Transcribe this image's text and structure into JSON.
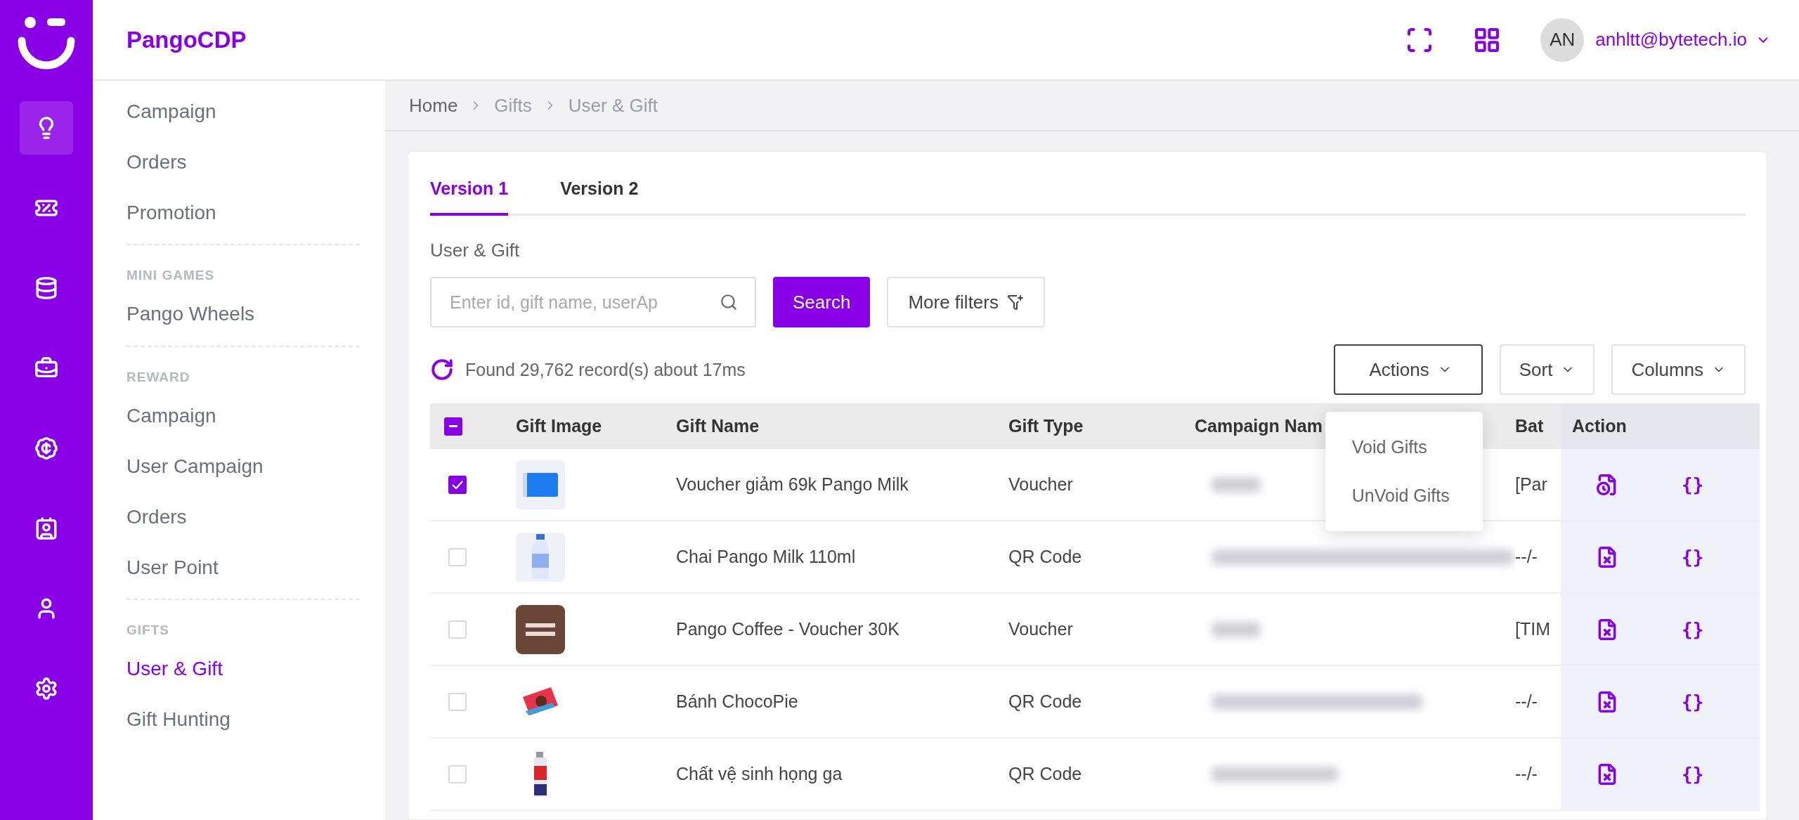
{
  "app": {
    "brand": "PangoCDP"
  },
  "rail": [
    {
      "selected": true
    },
    {
      "selected": false
    },
    {
      "selected": false
    },
    {
      "selected": false
    },
    {
      "selected": false
    },
    {
      "selected": false
    },
    {
      "selected": false
    },
    {
      "selected": false
    }
  ],
  "user": {
    "initials": "AN",
    "email": "anhltt@bytetech.io"
  },
  "sidebar": {
    "sections": [
      {
        "items": [
          {
            "label": "Campaign",
            "selected": false
          },
          {
            "label": "Orders",
            "selected": false
          },
          {
            "label": "Promotion",
            "selected": false
          }
        ]
      },
      {
        "heading": "MINI GAMES",
        "items": [
          {
            "label": "Pango Wheels",
            "selected": false
          }
        ]
      },
      {
        "heading": "REWARD",
        "items": [
          {
            "label": "Campaign",
            "selected": false
          },
          {
            "label": "User Campaign",
            "selected": false
          },
          {
            "label": "Orders",
            "selected": false
          },
          {
            "label": "User Point",
            "selected": false
          }
        ]
      },
      {
        "heading": "GIFTS",
        "items": [
          {
            "label": "User & Gift",
            "selected": true
          },
          {
            "label": "Gift Hunting",
            "selected": false
          }
        ]
      }
    ]
  },
  "breadcrumb": [
    "Home",
    "Gifts",
    "User & Gift"
  ],
  "tabs": [
    {
      "label": "Version 1",
      "selected": true
    },
    {
      "label": "Version 2",
      "selected": false
    }
  ],
  "section_title": "User & Gift",
  "search": {
    "placeholder": "Enter id, gift name, userAp",
    "button": "Search",
    "more_filters": "More filters"
  },
  "result_summary": "Found 29,762 record(s) about 17ms",
  "toolbar_buttons": [
    {
      "label": "Actions",
      "focused": true
    },
    {
      "label": "Sort",
      "focused": false
    },
    {
      "label": "Columns",
      "focused": false
    }
  ],
  "actions_menu": {
    "open": true,
    "items": [
      "Void Gifts",
      "UnVoid Gifts"
    ]
  },
  "table": {
    "select_all_indeterminate": true,
    "columns": [
      "Gift Image",
      "Gift Name",
      "Gift Type",
      "Campaign Nam",
      "Bat",
      "Action"
    ],
    "rows": [
      {
        "checked": true,
        "kind": "voucher",
        "name": "Voucher giảm 69k Pango Milk",
        "type": "Voucher",
        "campaign_blurred": true,
        "batch": "[Par",
        "voided": true,
        "json_label": "{}"
      },
      {
        "checked": false,
        "kind": "bottle",
        "name": "Chai Pango Milk 110ml",
        "type": "QR Code",
        "campaign_blurred": true,
        "batch": "--/-",
        "voided": false,
        "json_label": "{}"
      },
      {
        "checked": false,
        "kind": "coffee",
        "name": "Pango Coffee - Voucher 30K",
        "type": "Voucher",
        "campaign_blurred": true,
        "batch": "[TIM",
        "voided": false,
        "json_label": "{}"
      },
      {
        "checked": false,
        "kind": "snack",
        "name": "Bánh ChocoPie",
        "type": "QR Code",
        "campaign_blurred": true,
        "batch": "--/-",
        "voided": false,
        "json_label": "{}"
      },
      {
        "checked": false,
        "kind": "spray",
        "name": "Chất vệ sinh họng ga",
        "type": "QR Code",
        "campaign_blurred": true,
        "batch": "--/-",
        "voided": false,
        "json_label": "{}"
      }
    ]
  }
}
